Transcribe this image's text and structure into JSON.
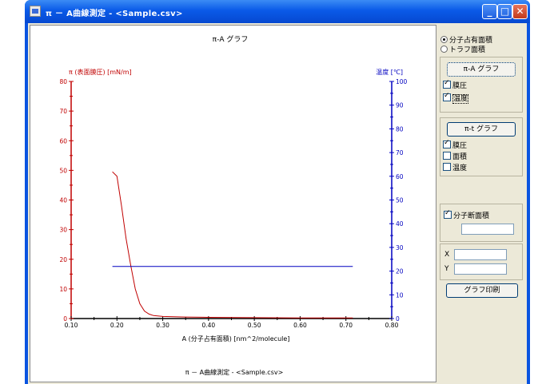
{
  "window": {
    "title": "π － A曲線測定 - <Sample.csv>",
    "controls": {
      "minimize": "_",
      "maximize": "□",
      "close": "✕"
    }
  },
  "chart_data": {
    "type": "line",
    "title": "π-A グラフ",
    "footer": "π － A曲線測定 - <Sample.csv>",
    "xlabel": "A (分子占有面積) [nm^2/molecule]",
    "ylabel_left": "π (表面膜圧) [mN/m]",
    "ylabel_right": "温度 [℃]",
    "xlim": [
      0.1,
      0.8
    ],
    "ylim_left": [
      0,
      80
    ],
    "ylim_right": [
      0,
      100
    ],
    "x_ticks": [
      "0.10",
      "0.20",
      "0.30",
      "0.40",
      "0.50",
      "0.60",
      "0.70",
      "0.80"
    ],
    "y_left_ticks": [
      "0",
      "10",
      "20",
      "30",
      "40",
      "50",
      "60",
      "70",
      "80"
    ],
    "y_right_ticks": [
      "0",
      "10",
      "20",
      "30",
      "40",
      "50",
      "60",
      "70",
      "80",
      "90",
      "100"
    ],
    "grid": false,
    "series": [
      {
        "axis": "left",
        "color": "#c00000",
        "x": [
          0.19,
          0.2,
          0.21,
          0.22,
          0.23,
          0.24,
          0.25,
          0.26,
          0.27,
          0.28,
          0.3,
          0.35,
          0.4,
          0.5,
          0.6,
          0.715
        ],
        "y": [
          49.5,
          48.0,
          38.0,
          27.0,
          18.0,
          10.0,
          5.0,
          2.5,
          1.5,
          1.0,
          0.7,
          0.5,
          0.4,
          0.3,
          0.2,
          0.2
        ]
      },
      {
        "axis": "right",
        "color": "#0000c0",
        "x": [
          0.19,
          0.715
        ],
        "y": [
          22.0,
          22.0
        ]
      }
    ]
  },
  "panel": {
    "radio_occupied": "分子占有面積",
    "radio_trough": "トラフ面積",
    "pi_a_button": "π-A グラフ",
    "pi_a_pressure": "膜圧",
    "pi_a_temp": "温度",
    "pi_t_button": "π-t グラフ",
    "pi_t_pressure": "膜圧",
    "pi_t_area": "面積",
    "pi_t_temp": "温度",
    "cross_section": "分子断面積",
    "x_label": "X",
    "y_label": "Y",
    "print_button": "グラフ印刷"
  }
}
